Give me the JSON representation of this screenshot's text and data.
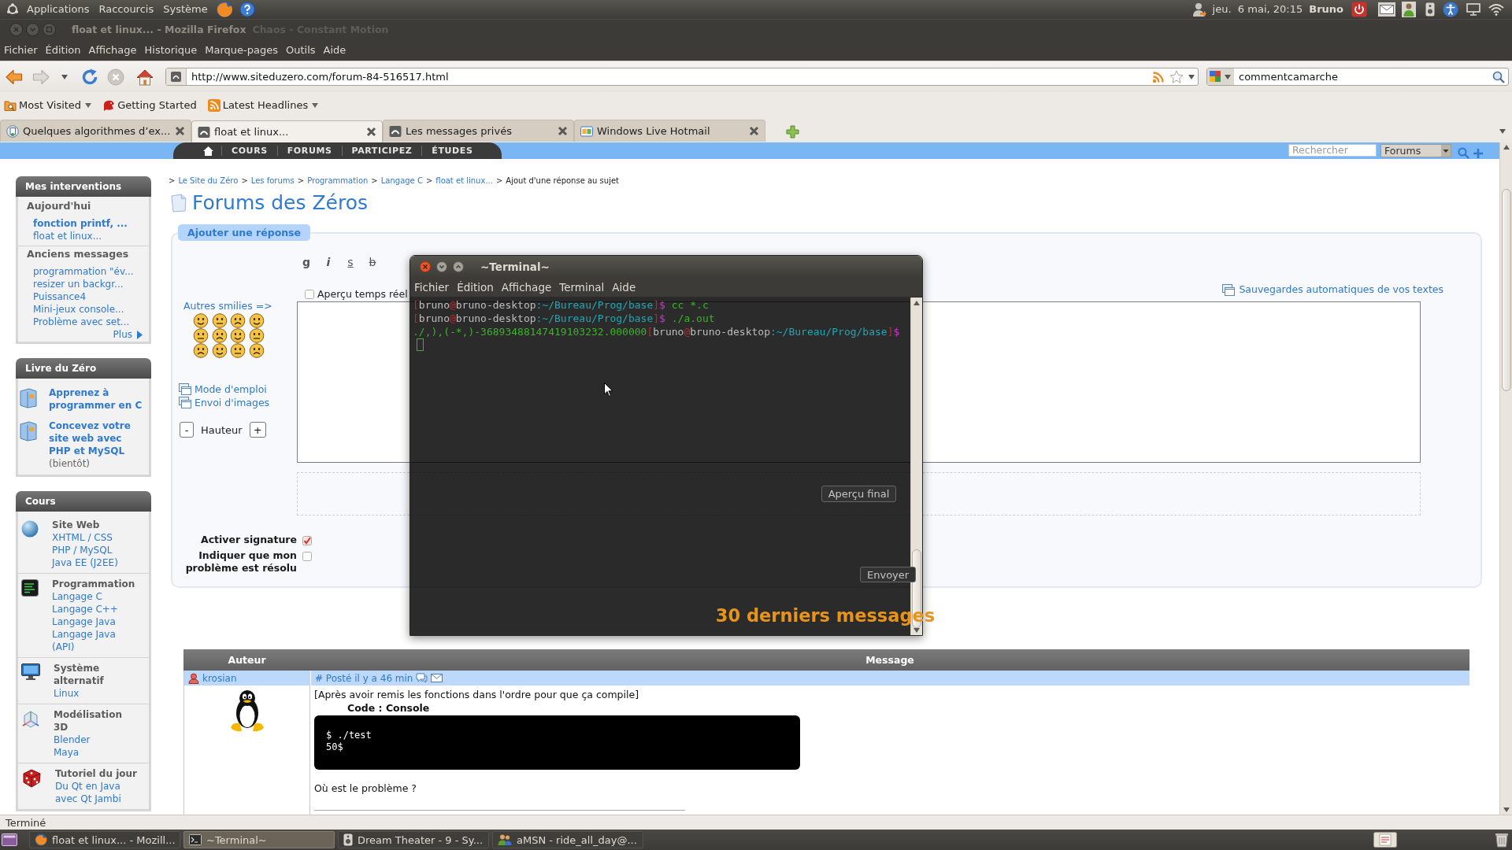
{
  "desktop_panel": {
    "menus": [
      "Applications",
      "Raccourcis",
      "Système"
    ],
    "clock": "jeu.  6 mai, 20:15",
    "user": "Bruno"
  },
  "browser": {
    "title": "float et linux... - Mozilla Firefox",
    "overlay_title": "Chaos - Constant Motion",
    "menu": [
      "Fichier",
      "Édition",
      "Affichage",
      "Historique",
      "Marque-pages",
      "Outils",
      "Aide"
    ],
    "address": "http://www.siteduzero.com/forum-84-516517.html",
    "search_value": "commentcamarche",
    "bookmarks": [
      {
        "label": "Most Visited",
        "kind": "folder",
        "dropdown": true
      },
      {
        "label": "Getting Started",
        "kind": "page",
        "dropdown": false
      },
      {
        "label": "Latest Headlines",
        "kind": "feed",
        "dropdown": true
      }
    ],
    "tabs": [
      {
        "label": "Quelques algorithmes d’ex...",
        "kind": "document",
        "selected": false
      },
      {
        "label": "float et linux...",
        "kind": "site",
        "selected": true
      },
      {
        "label": "Les messages privés",
        "kind": "site",
        "selected": false
      },
      {
        "label": "Windows Live Hotmail",
        "kind": "mail",
        "selected": false
      }
    ],
    "status": "Terminé"
  },
  "site": {
    "nav": [
      "COURS",
      "FORUMS",
      "PARTICIPEZ",
      "ÉTUDES"
    ],
    "search": {
      "placeholder": "Rechercher",
      "scope": "Forums"
    },
    "sidebar": [
      {
        "kind": "messages",
        "title": "Mes interventions",
        "groups": [
          {
            "heading": "Aujourd'hui",
            "links": [
              {
                "label": "fonction printf, ...",
                "unread": true
              },
              {
                "label": "float et linux...",
                "unread": false
              }
            ]
          },
          {
            "heading": "Anciens messages",
            "links": [
              {
                "label": "programmation \"év...",
                "unread": false
              },
              {
                "label": "resizer un backgr...",
                "unread": false
              },
              {
                "label": "Puissance4",
                "unread": false
              },
              {
                "label": "Mini-jeux console...",
                "unread": false
              },
              {
                "label": "Problème avec set...",
                "unread": false
              }
            ]
          }
        ],
        "more": "Plus"
      },
      {
        "kind": "books",
        "title": "Livre du Zéro",
        "books": [
          {
            "title": "Apprenez à programmer en C"
          },
          {
            "title": "Concevez votre site web avec PHP et MySQL",
            "note": "(bientôt)"
          }
        ]
      },
      {
        "kind": "courses",
        "title": "Cours",
        "categories": [
          {
            "kind": "web",
            "name": "Site Web",
            "links": [
              "XHTML / CSS",
              "PHP / MySQL",
              "Java EE (J2EE)"
            ]
          },
          {
            "kind": "programming",
            "name": "Programmation",
            "links": [
              "Langage C",
              "Langage C++",
              "Langage Java",
              "Langage Java (API)"
            ]
          },
          {
            "kind": "system",
            "name": "Système alternatif",
            "links": [
              "Linux"
            ]
          },
          {
            "kind": "modeling",
            "name": "Modélisation 3D",
            "links": [
              "Blender",
              "Maya"
            ]
          },
          {
            "kind": "tutorial",
            "name": "Tutoriel du jour",
            "links": [
              "Du Qt en Java avec Qt Jambi"
            ]
          }
        ]
      }
    ],
    "breadcrumb": {
      "separator": ">",
      "links": [
        "Le Site du Zéro",
        "Les forums",
        "Programmation",
        "Langage C",
        "float et linux..."
      ],
      "current": "Ajout d'une réponse au sujet"
    },
    "title": "Forums des Zéros",
    "reply_form": {
      "tab": "Ajouter une réponse",
      "format_buttons": [
        {
          "label": "g",
          "kind": "bold"
        },
        {
          "label": "i",
          "kind": "italic"
        },
        {
          "label": "s",
          "kind": "underline"
        },
        {
          "label": "b",
          "kind": "strike"
        }
      ],
      "live_preview": {
        "label": "Aperçu temps réel",
        "checked": false
      },
      "autosave_link": "Sauvegardes automatiques de vos textes",
      "smilies_link": "Autres smilies =>",
      "help_links": [
        "Mode d'emploi",
        "Envoi d'images"
      ],
      "height": {
        "decrease": "-",
        "label": "Hauteur",
        "increase": "+"
      },
      "preview_button": "Aperçu final",
      "options": [
        {
          "label": "Activer signature",
          "checked": true
        },
        {
          "label": "Indiquer que mon problème est résolu",
          "checked": false
        }
      ],
      "submit": "Envoyer"
    },
    "recent_heading": "30 derniers messages",
    "posts_table": {
      "columns": [
        "Auteur",
        "Message"
      ],
      "posts": [
        {
          "author": "krosian",
          "meta": "# Posté il y a 46 min",
          "intro": "[Après avoir remis les fonctions dans l'ordre pour que ça compile]",
          "code_title": "Code : Console",
          "code": [
            "$ ./test",
            "50$"
          ],
          "closing": "Où est le problème ?"
        }
      ]
    }
  },
  "terminal": {
    "title": "~Terminal~",
    "menu": [
      "Fichier",
      "Édition",
      "Affichage",
      "Terminal",
      "Aide"
    ],
    "lines": [
      [
        {
          "text": "[",
          "kind": "punct"
        },
        {
          "text": "bruno",
          "kind": "name"
        },
        {
          "text": "@",
          "kind": "punct"
        },
        {
          "text": "bruno-desktop",
          "kind": "name"
        },
        {
          "text": ":~/Bureau/Prog/base",
          "kind": "path"
        },
        {
          "text": "]",
          "kind": "punct"
        },
        {
          "text": "$",
          "kind": "dollar"
        },
        {
          "text": " cc *.c",
          "kind": "command"
        }
      ],
      [
        {
          "text": "[",
          "kind": "punct"
        },
        {
          "text": "bruno",
          "kind": "name"
        },
        {
          "text": "@",
          "kind": "punct"
        },
        {
          "text": "bruno-desktop",
          "kind": "name"
        },
        {
          "text": ":~/Bureau/Prog/base",
          "kind": "path"
        },
        {
          "text": "]",
          "kind": "punct"
        },
        {
          "text": "$",
          "kind": "dollar"
        },
        {
          "text": " ./a.out",
          "kind": "command"
        }
      ],
      [
        {
          "text": "./,),(-*,)-36893488147419103232.000000",
          "kind": "output"
        },
        {
          "text": "[",
          "kind": "punct"
        },
        {
          "text": "bruno",
          "kind": "name"
        },
        {
          "text": "@",
          "kind": "punct"
        },
        {
          "text": "bruno-desktop",
          "kind": "name"
        },
        {
          "text": ":~/Bureau/Prog/base",
          "kind": "path"
        },
        {
          "text": "]",
          "kind": "punct"
        },
        {
          "text": "$",
          "kind": "dollar"
        }
      ]
    ]
  },
  "taskbar": {
    "items": [
      {
        "label": "float et linux... - Mozill...",
        "kind": "browser",
        "selected": false
      },
      {
        "label": "~Terminal~",
        "kind": "terminal",
        "selected": true
      },
      {
        "label": "Dream Theater - 9 - Sy...",
        "kind": "player",
        "selected": false
      },
      {
        "label": "aMSN - ride_all_day@...",
        "kind": "messenger",
        "selected": false
      }
    ]
  }
}
